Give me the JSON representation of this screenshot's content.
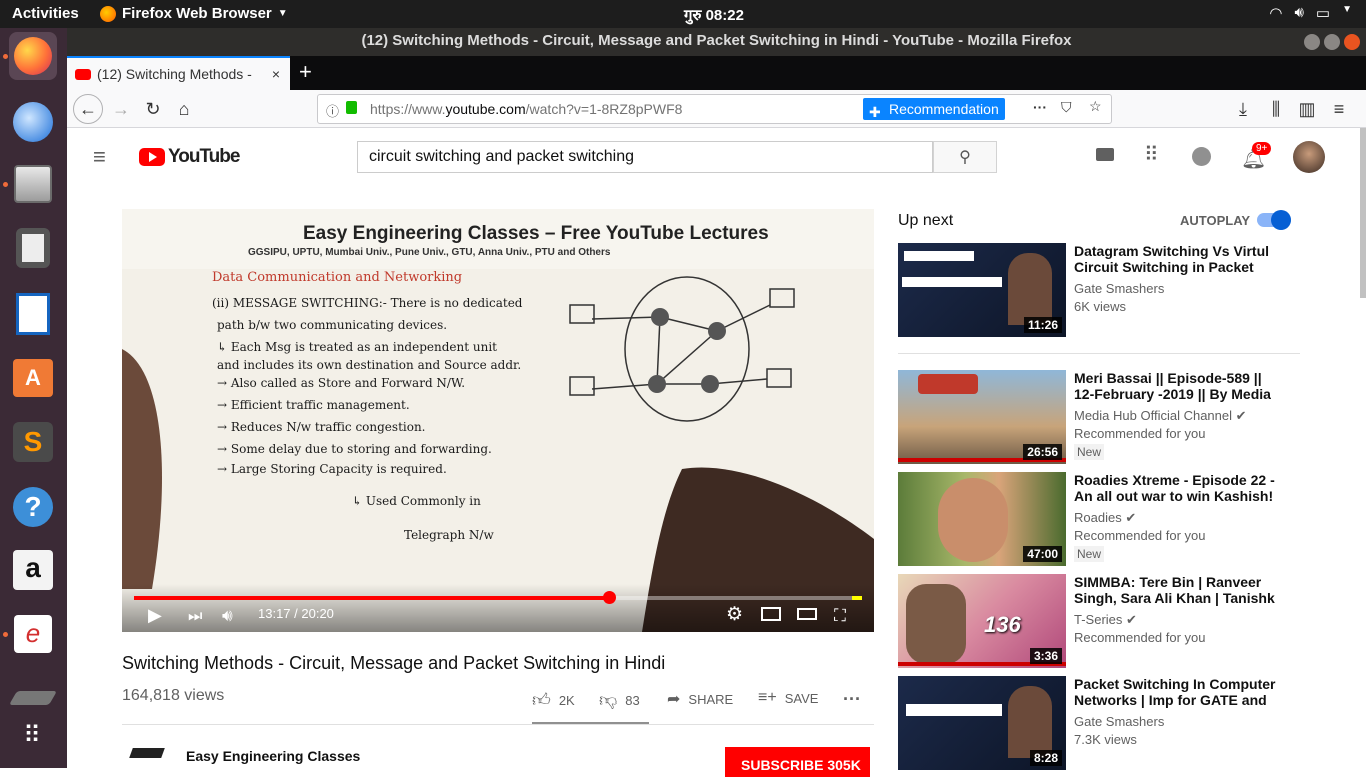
{
  "topbar": {
    "activities": "Activities",
    "app": "Firefox Web Browser",
    "clock": "गुरु 08:22"
  },
  "window": {
    "title": "(12) Switching Methods - Circuit, Message and Packet Switching in Hindi - YouTube - Mozilla Firefox"
  },
  "tab": {
    "title": "(12) Switching Methods - ",
    "close": "×",
    "new": "+"
  },
  "url": {
    "prefix": "https://www.",
    "domain": "youtube.com",
    "path": "/watch?v=1-8RZ8pPWF8",
    "rec_label": "Recommendation"
  },
  "youtube": {
    "logo": "YouTube",
    "search_value": "circuit switching and packet switching",
    "notif_count": "9+",
    "video": {
      "title": "Switching Methods - Circuit, Message and Packet Switching in Hindi",
      "views": "164,818 views",
      "time": "13:17 / 20:20",
      "progress_fraction": 0.653,
      "likes": "2K",
      "dislikes": "83",
      "share": "SHARE",
      "save": "SAVE",
      "channel": "Easy Engineering Classes",
      "subscribe": "SUBSCRIBE  305K",
      "header_line1": "Easy Engineering Classes – Free YouTube Lectures",
      "header_line2": "GGSIPU, UPTU, Mumbai Univ., Pune Univ., GTU, Anna Univ., PTU and Others",
      "notes_heading": "Data Communication and Networking",
      "notes_lines": [
        "(ii) MESSAGE SWITCHING:- There is no dedicated",
        "path b/w two communicating devices.",
        "↳ Each Msg is treated as an independent unit",
        "and includes its own destination and Source addr.",
        "→ Also called as Store and Forward N/W.",
        "→ Efficient traffic management.",
        "→ Reduces N/w traffic congestion.",
        "→ Some delay due to storing and forwarding.",
        "→ Large Storing Capacity is required.",
        "↳ Used Commonly in",
        "Telegraph N/w"
      ]
    },
    "upnext": "Up next",
    "autoplay": "AUTOPLAY",
    "recs": [
      {
        "title": "Datagram Switching Vs Virtul Circuit Switching in Packet",
        "channel": "Gate Smashers",
        "meta": "6K views",
        "duration": "11:26",
        "new": ""
      },
      {
        "title": "Meri Bassai || Episode-589 || 12-February -2019 || By Media",
        "channel": "Media Hub Official Channel",
        "meta": "Recommended for you",
        "duration": "26:56",
        "new": "New"
      },
      {
        "title": "Roadies Xtreme - Episode 22 - An all out war to win Kashish!",
        "channel": "Roadies",
        "meta": "Recommended for you",
        "duration": "47:00",
        "new": "New"
      },
      {
        "title": "SIMMBA: Tere Bin | Ranveer Singh, Sara Ali Khan | Tanishk",
        "channel": "T-Series",
        "meta": "Recommended for you",
        "duration": "3:36",
        "new": ""
      },
      {
        "title": "Packet Switching In Computer Networks | Imp for GATE and",
        "channel": "Gate Smashers",
        "meta": "7.3K views",
        "duration": "8:28",
        "new": ""
      }
    ]
  }
}
